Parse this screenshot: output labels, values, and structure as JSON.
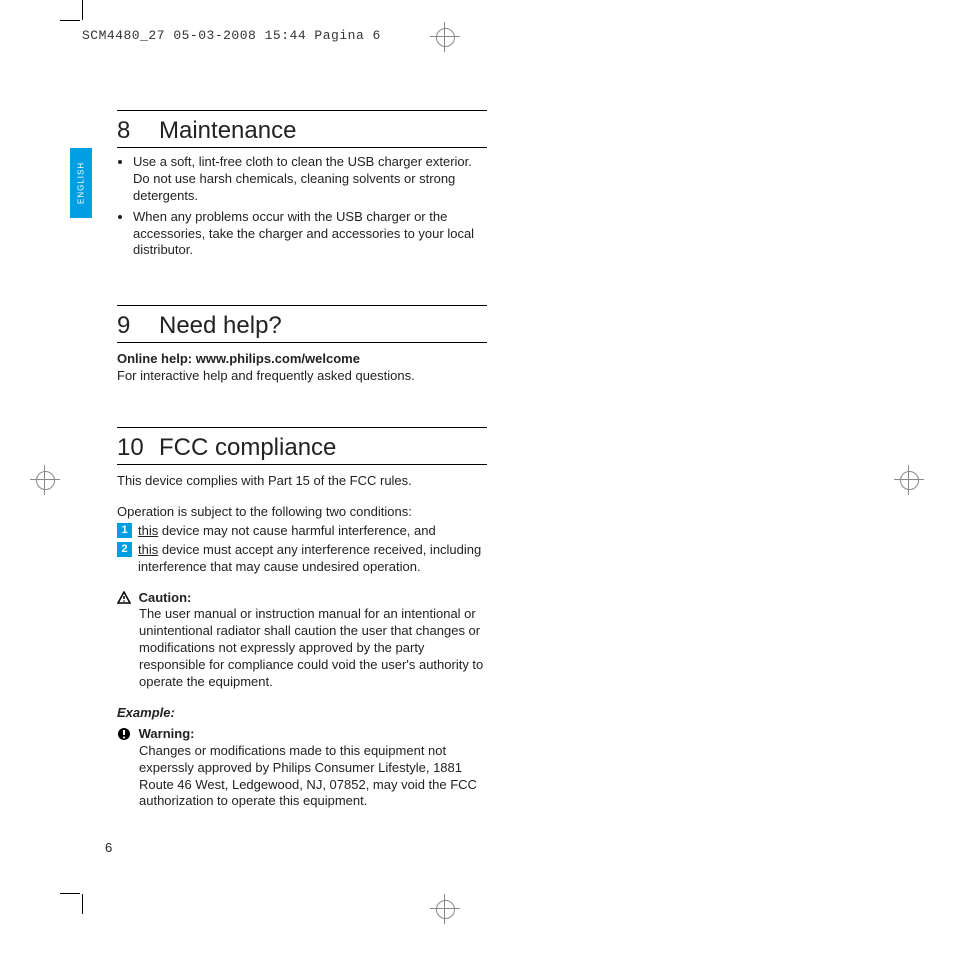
{
  "header": "SCM4480_27  05-03-2008  15:44  Pagina 6",
  "lang_tab": "ENGLISH",
  "page_number": "6",
  "sections": {
    "s8": {
      "num": "8",
      "title": "Maintenance",
      "b1": "Use a soft, lint-free cloth to clean the USB charger exterior. Do not use harsh chemicals, cleaning solvents or strong detergents.",
      "b2": "When any problems occur with the USB charger or the accessories, take the charger and accessories to your local distributor."
    },
    "s9": {
      "num": "9",
      "title": "Need help?",
      "bold": "Online help: www.philips.com/welcome",
      "line": "For interactive help and frequently asked questions."
    },
    "s10": {
      "num": "10",
      "title": "FCC compliance",
      "p1": "This device complies with Part 15 of the FCC rules.",
      "p2": "Operation is subject to the following two conditions:",
      "n1": "1",
      "n2": "2",
      "step1_u": "this",
      "step1_rest": " device may not cause harmful interference, and",
      "step2_u": "this",
      "step2_rest": " device must accept any interference received, including interference that may cause undesired operation.",
      "caution_label": "Caution:",
      "caution_body": "The user manual or instruction manual for an intentional or unintentional radiator shall caution the user that changes or modifications not expressly approved by the party responsible for compliance could void the user's authority to operate the equipment.",
      "example": "Example:",
      "warning_label": "Warning:",
      "warning_body": "Changes or modifications made to this equipment not experssly approved by Philips Consumer Lifestyle, 1881 Route 46 West, Ledgewood, NJ, 07852, may void the FCC authorization to operate this equipment."
    }
  }
}
